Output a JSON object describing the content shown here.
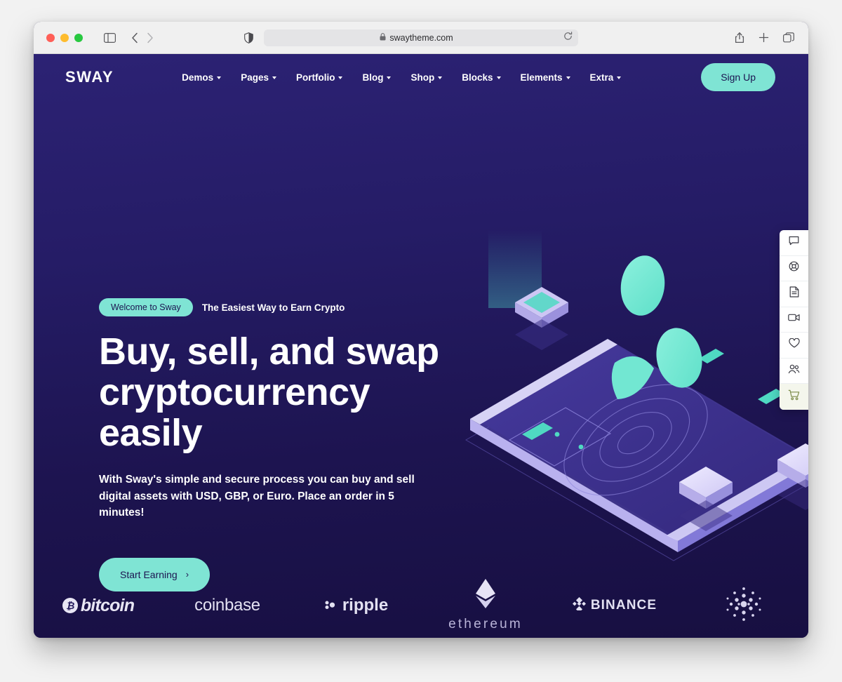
{
  "browser": {
    "url": "swaytheme.com",
    "lock_icon": "lock-icon",
    "shield_icon": "privacy-shield-icon",
    "reload_icon": "reload-icon",
    "sidebar_icon": "sidebar-toggle-icon",
    "back_icon": "back-arrow-icon",
    "forward_icon": "forward-arrow-icon",
    "share_icon": "share-icon",
    "newtab_icon": "plus-icon",
    "tabs_icon": "tab-overview-icon"
  },
  "site": {
    "logo": "SWAY",
    "nav_items": [
      {
        "label": "Demos"
      },
      {
        "label": "Pages"
      },
      {
        "label": "Portfolio"
      },
      {
        "label": "Blog"
      },
      {
        "label": "Shop"
      },
      {
        "label": "Blocks"
      },
      {
        "label": "Elements"
      },
      {
        "label": "Extra"
      }
    ],
    "signup_label": "Sign Up"
  },
  "hero": {
    "badge": "Welcome to Sway",
    "eyebrow": "The Easiest Way to Earn Crypto",
    "headline_line1": "Buy, sell, and swap",
    "headline_line2": "cryptocurrency easily",
    "subcopy": "With Sway's simple and secure process you can buy and sell digital assets with USD, GBP, or Euro. Place an order in 5 minutes!",
    "cta_label": "Start Earning",
    "cta_chevron": "›"
  },
  "rail": {
    "items": [
      {
        "icon": "chat-bubble-icon"
      },
      {
        "icon": "lifebuoy-support-icon"
      },
      {
        "icon": "document-icon"
      },
      {
        "icon": "video-camera-icon"
      },
      {
        "icon": "heart-icon"
      },
      {
        "icon": "users-icon"
      },
      {
        "icon": "shopping-cart-icon"
      }
    ]
  },
  "partners": [
    {
      "name": "bitcoin",
      "symbol": "₿"
    },
    {
      "name": "coinbase"
    },
    {
      "name": "ripple"
    },
    {
      "name": "ethereum"
    },
    {
      "name": "BINANCE"
    },
    {
      "name": "cardano"
    }
  ],
  "colors": {
    "accent_teal": "#7fe4d4",
    "bg_top": "#2c2274",
    "bg_bottom": "#170f41",
    "text_white": "#ffffff"
  }
}
